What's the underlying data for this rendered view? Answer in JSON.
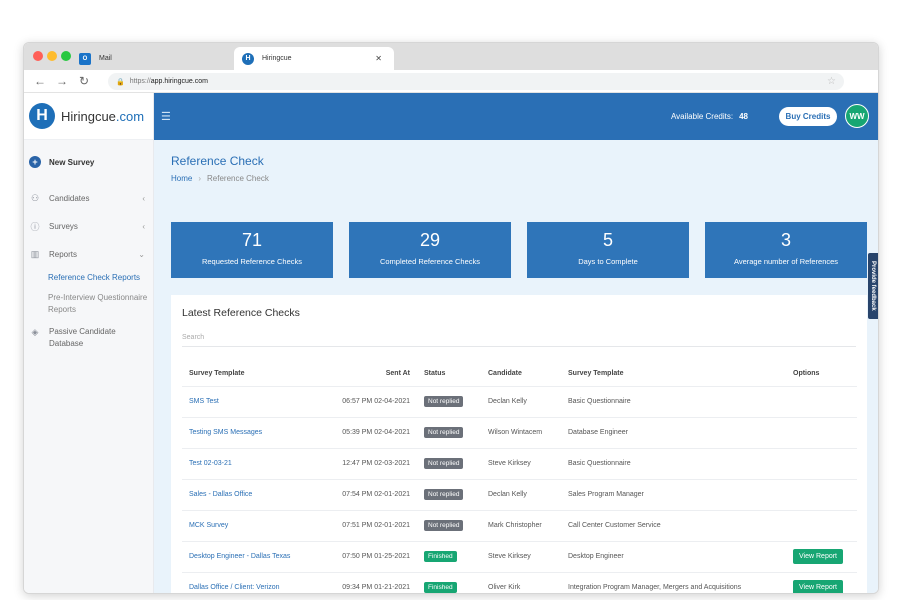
{
  "browser": {
    "tabs": [
      {
        "label": "Mail",
        "icon": "outlook-icon"
      },
      {
        "label": "Hiringcue",
        "icon": "hiringcue-icon"
      }
    ],
    "url_prefix": "https://",
    "url_host": "app.hiringcue.com"
  },
  "logo": {
    "name": "Hiringcue",
    "suffix": ".com",
    "mark": "H"
  },
  "sidebar": {
    "new_survey": "New Survey",
    "items": [
      {
        "label": "Candidates",
        "icon": "candidates-icon"
      },
      {
        "label": "Surveys",
        "icon": "question-icon"
      },
      {
        "label": "Reports",
        "icon": "bar-chart-icon"
      }
    ],
    "reports_sub": [
      {
        "label": "Reference Check Reports"
      },
      {
        "label": "Pre-Interview Questionnaire Reports"
      }
    ],
    "passive": "Passive Candidate Database"
  },
  "topbar": {
    "credits_label": "Available Credits:",
    "credits_value": "48",
    "buy_label": "Buy Credits",
    "avatar_initials": "WW"
  },
  "page": {
    "title": "Reference Check",
    "breadcrumb_home": "Home",
    "breadcrumb_current": "Reference Check"
  },
  "stats": [
    {
      "value": "71",
      "label": "Requested Reference Checks"
    },
    {
      "value": "29",
      "label": "Completed Reference Checks"
    },
    {
      "value": "5",
      "label": "Days to Complete"
    },
    {
      "value": "3",
      "label": "Average number of References"
    }
  ],
  "feedback_label": "Provide feedback",
  "panel": {
    "title": "Latest Reference Checks",
    "search_placeholder": "Search",
    "columns": [
      "Survey Template",
      "Sent At",
      "Status",
      "Candidate",
      "Survey Template",
      "Options"
    ],
    "rows": [
      {
        "template": "SMS Test",
        "sent": "06:57 PM 02-04-2021",
        "status": "Not replied",
        "candidate": "Declan Kelly",
        "survey": "Basic Questionnaire",
        "option": ""
      },
      {
        "template": "Testing SMS Messages",
        "sent": "05:39 PM 02-04-2021",
        "status": "Not replied",
        "candidate": "Wilson Wintacem",
        "survey": "Database Engineer",
        "option": ""
      },
      {
        "template": "Test 02-03-21",
        "sent": "12:47 PM 02-03-2021",
        "status": "Not replied",
        "candidate": "Steve Kirksey",
        "survey": "Basic Questionnaire",
        "option": ""
      },
      {
        "template": "Sales - Dallas Office",
        "sent": "07:54 PM 02-01-2021",
        "status": "Not replied",
        "candidate": "Declan Kelly",
        "survey": "Sales Program Manager",
        "option": ""
      },
      {
        "template": "MCK Survey",
        "sent": "07:51 PM 02-01-2021",
        "status": "Not replied",
        "candidate": "Mark Christopher",
        "survey": "Call Center Customer Service",
        "option": ""
      },
      {
        "template": "Desktop Engineer - Dallas Texas",
        "sent": "07:50 PM 01-25-2021",
        "status": "Finished",
        "candidate": "Steve Kirksey",
        "survey": "Desktop Engineer",
        "option": "View Report"
      },
      {
        "template": "Dallas Office / Client: Verizon",
        "sent": "09:34 PM 01-21-2021",
        "status": "Finished",
        "candidate": "Oliver Kirk",
        "survey": "Integration Program Manager, Mergers and Acquisitions",
        "option": "View Report"
      }
    ]
  }
}
